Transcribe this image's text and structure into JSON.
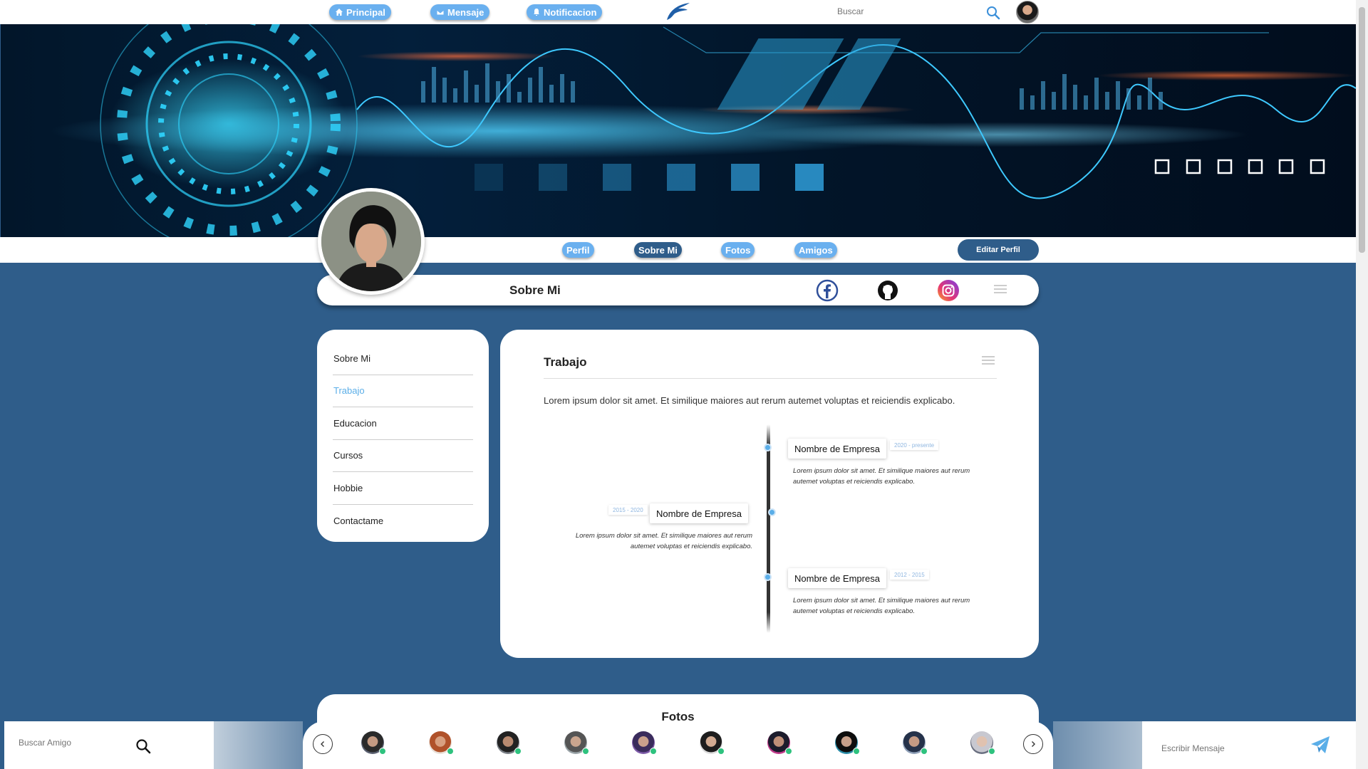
{
  "nav": {
    "items": [
      {
        "label": "Principal",
        "icon": "home-icon"
      },
      {
        "label": "Mensaje",
        "icon": "mail-icon"
      },
      {
        "label": "Notificacion",
        "icon": "bell-icon"
      }
    ],
    "search_placeholder": "Buscar"
  },
  "profile": {
    "tabs": [
      "Perfil",
      "Sobre Mi",
      "Fotos",
      "Amigos"
    ],
    "active_tab": "Sobre Mi",
    "edit_label": "Editar Perfil",
    "section_title": "Sobre Mi",
    "social": [
      "facebook-icon",
      "github-icon",
      "instagram-icon"
    ]
  },
  "sidemenu": {
    "items": [
      "Sobre Mi",
      "Trabajo",
      "Educacion",
      "Cursos",
      "Hobbie",
      "Contactame"
    ],
    "active": "Trabajo"
  },
  "work": {
    "title": "Trabajo",
    "intro": "Lorem ipsum dolor sit amet. Et similique maiores aut rerum autemet voluptas et reiciendis explicabo.",
    "entries": [
      {
        "company": "Nombre de Empresa",
        "dates": "2020 - presente",
        "text": "Lorem ipsum dolor sit amet. Et similique maiores aut rerum autemet voluptas et reiciendis explicabo."
      },
      {
        "company": "Nombre de Empresa",
        "dates": "2015 - 2020",
        "text": "Lorem ipsum dolor sit amet. Et similique maiores aut rerum autemet voluptas et reiciendis explicabo."
      },
      {
        "company": "Nombre de Empresa",
        "dates": "2012 - 2015",
        "text": "Lorem ipsum dolor sit amet. Et similique maiores aut rerum autemet voluptas et reiciendis explicabo."
      }
    ]
  },
  "photos": {
    "title": "Fotos"
  },
  "bottom": {
    "friend_search_placeholder": "Buscar Amigo",
    "message_placeholder": "Escribir Mensaje",
    "friends_online": [
      true,
      true,
      true,
      true,
      true,
      true,
      true,
      true,
      true,
      true
    ]
  },
  "colors": {
    "accent": "#6ab0ef",
    "primary": "#2f5d8a",
    "online": "#2ec27e"
  }
}
